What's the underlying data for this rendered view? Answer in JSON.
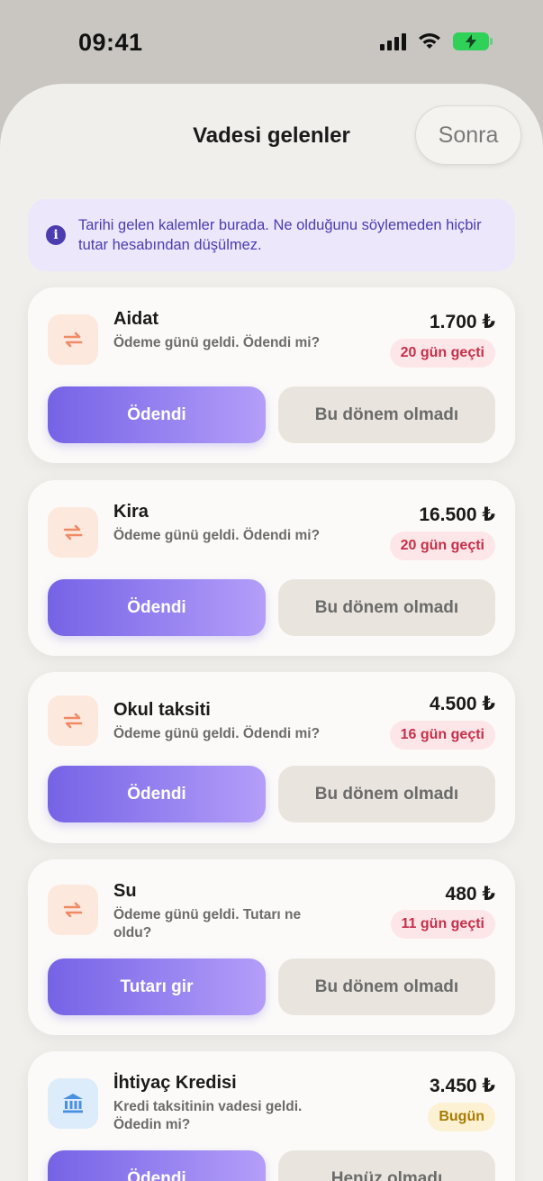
{
  "status": {
    "time": "09:41"
  },
  "header": {
    "title": "Vadesi gelenler",
    "later_label": "Sonra"
  },
  "info": {
    "icon": "info-icon",
    "text": "Tarihi gelen kalemler burada. Ne olduğunu söylemeden hiçbir tutar hesabından düşülmez."
  },
  "colors": {
    "accent": "#7563e6",
    "overdue": "#c5304a",
    "today": "#a77a00",
    "sheet": "#f1efec"
  },
  "items": [
    {
      "icon": "repeat-icon",
      "name": "Aidat",
      "desc": "Ödeme günü geldi. Ödendi mi?",
      "amount": "1.700 ₺",
      "badge": "20 gün geçti",
      "primary": "Ödendi",
      "secondary": "Bu dönem olmadı"
    },
    {
      "icon": "repeat-icon",
      "name": "Kira",
      "desc": "Ödeme günü geldi. Ödendi mi?",
      "amount": "16.500 ₺",
      "badge": "20 gün geçti",
      "primary": "Ödendi",
      "secondary": "Bu dönem olmadı"
    },
    {
      "icon": "repeat-icon",
      "name": "Okul taksiti",
      "desc": "Ödeme günü geldi. Ödendi mi?",
      "amount": "4.500 ₺",
      "badge": "16 gün geçti",
      "primary": "Ödendi",
      "secondary": "Bu dönem olmadı"
    },
    {
      "icon": "repeat-icon",
      "name": "Su",
      "desc": "Ödeme günü geldi. Tutarı ne oldu?",
      "amount": "480 ₺",
      "badge": "11 gün geçti",
      "primary": "Tutarı gir",
      "secondary": "Bu dönem olmadı"
    },
    {
      "icon": "bank-icon",
      "name": "İhtiyaç Kredisi",
      "desc": "Kredi taksitinin vadesi geldi. Ödedin mi?",
      "amount": "3.450 ₺",
      "badge": "Bugün",
      "primary": "Ödendi",
      "secondary": "Henüz olmadı"
    }
  ]
}
